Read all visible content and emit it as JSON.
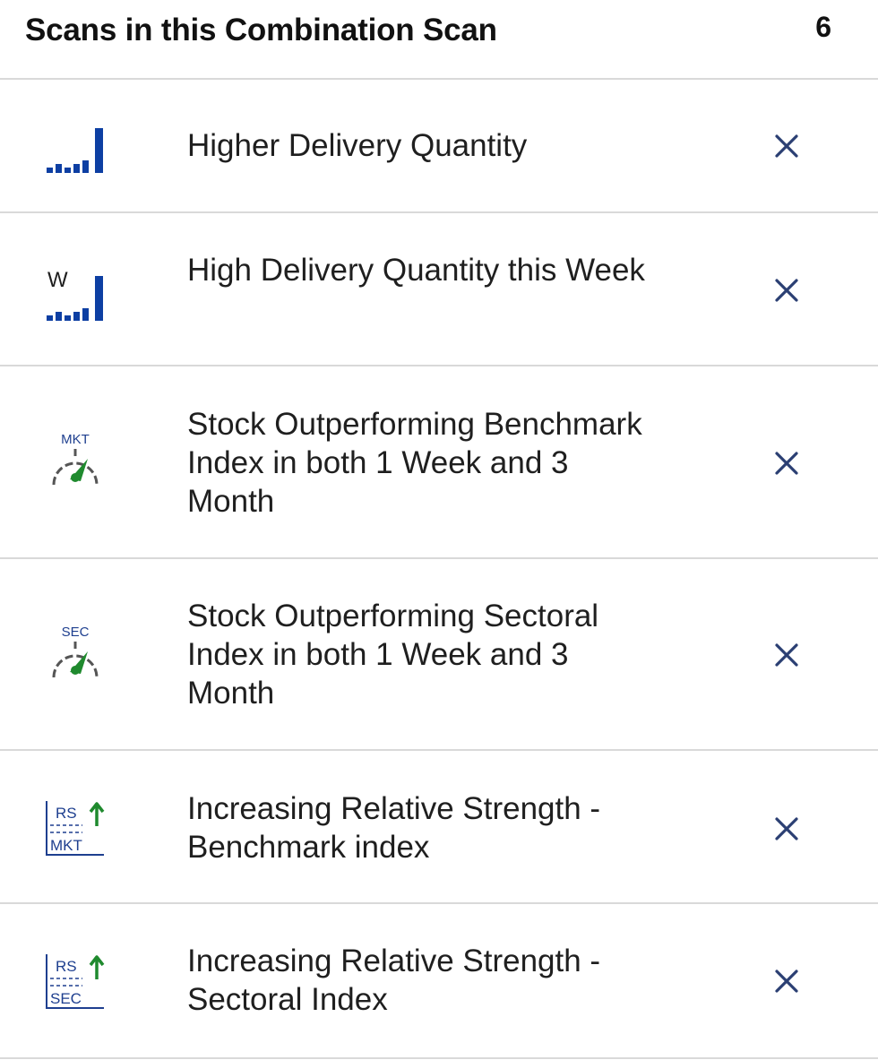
{
  "header": {
    "title": "Scans in this Combination Scan",
    "count": "6"
  },
  "colors": {
    "icon_blue": "#0d3fa3",
    "icon_green": "#1f8a2e",
    "close_x": "#2b3f73",
    "divider": "#d9d9d9"
  },
  "scans": [
    {
      "label": "Higher Delivery Quantity",
      "icon": "delivery-bars-icon",
      "icon_text": ""
    },
    {
      "label": "High Delivery Quantity this Week",
      "icon": "weekly-delivery-bars-icon",
      "icon_text": "W"
    },
    {
      "label": "Stock Outperforming Benchmark Index in both 1 Week and 3 Month",
      "icon": "market-gauge-icon",
      "icon_text": "MKT"
    },
    {
      "label": "Stock Outperforming Sectoral Index in both 1 Week and 3 Month",
      "icon": "sector-gauge-icon",
      "icon_text": "SEC"
    },
    {
      "label": "Increasing Relative Strength - Benchmark index",
      "icon": "relative-strength-market-icon",
      "icon_text_top": "RS",
      "icon_text_bottom": "MKT"
    },
    {
      "label": "Increasing Relative Strength - Sectoral Index",
      "icon": "relative-strength-sector-icon",
      "icon_text_top": "RS",
      "icon_text_bottom": "SEC"
    }
  ]
}
